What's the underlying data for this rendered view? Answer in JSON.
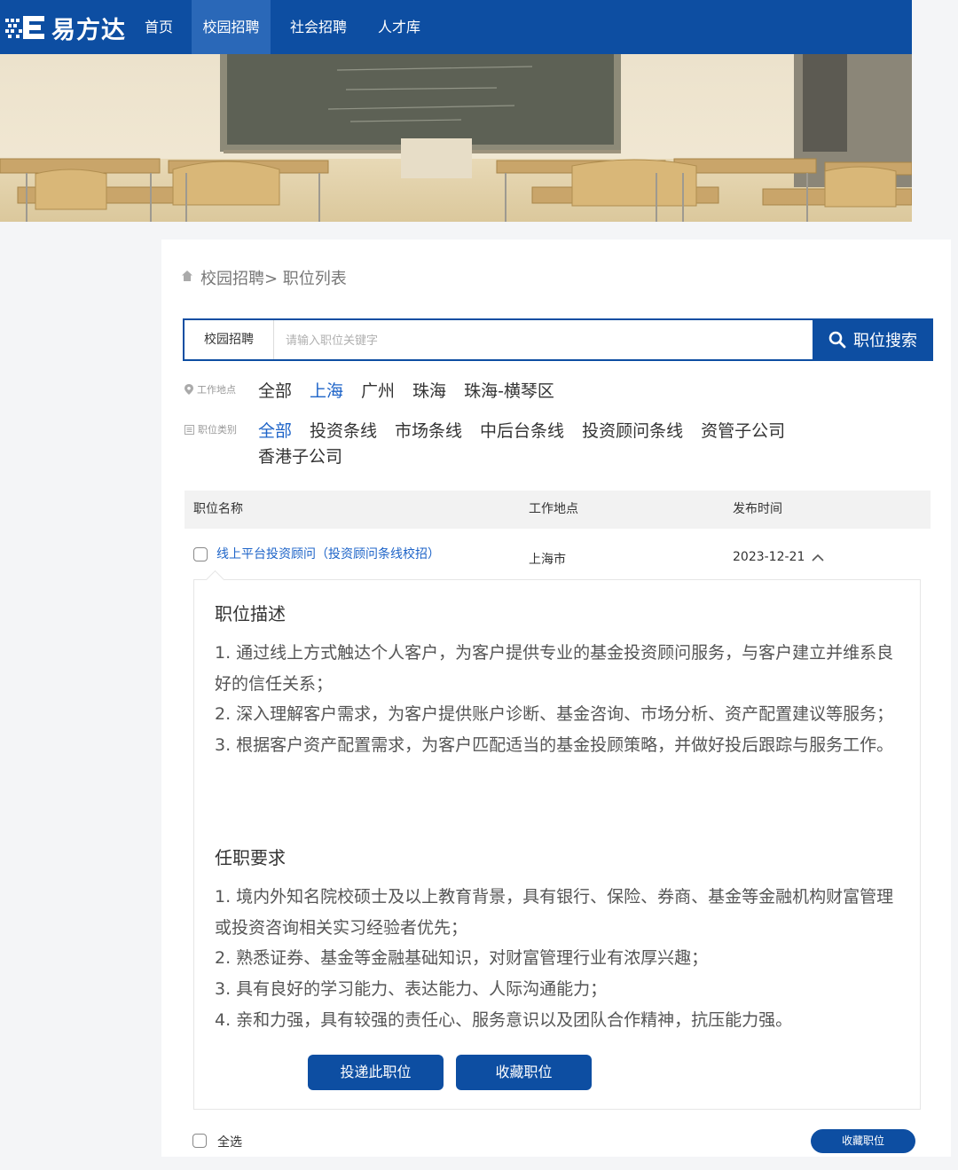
{
  "nav": {
    "brand": "易方达",
    "items": [
      {
        "label": "首页",
        "active": false
      },
      {
        "label": "校园招聘",
        "active": true
      },
      {
        "label": "社会招聘",
        "active": false
      },
      {
        "label": "人才库",
        "active": false
      }
    ]
  },
  "breadcrumb": "校园招聘> 职位列表",
  "search": {
    "scope": "校园招聘",
    "placeholder": "请输入职位关键字",
    "button_label": "职位搜索"
  },
  "filters": {
    "location": {
      "label": "工作地点",
      "options": [
        "全部",
        "上海",
        "广州",
        "珠海",
        "珠海-横琴区"
      ],
      "selected": "上海"
    },
    "category": {
      "label": "职位类别",
      "options": [
        "全部",
        "投资条线",
        "市场条线",
        "中后台条线",
        "投资顾问条线",
        "资管子公司",
        "香港子公司"
      ],
      "selected": "全部"
    }
  },
  "table": {
    "headers": {
      "title": "职位名称",
      "location": "工作地点",
      "date": "发布时间"
    },
    "rows": [
      {
        "title": "线上平台投资顾问（投资顾问条线校招）",
        "location": "上海市",
        "date": "2023-12-21",
        "expanded": true
      }
    ]
  },
  "detail": {
    "desc_title": "职位描述",
    "desc": [
      "1. 通过线上方式触达个人客户，为客户提供专业的基金投资顾问服务，与客户建立并维系良好的信任关系；",
      "2. 深入理解客户需求，为客户提供账户诊断、基金咨询、市场分析、资产配置建议等服务；",
      "3. 根据客户资产配置需求，为客户匹配适当的基金投顾策略，并做好投后跟踪与服务工作。"
    ],
    "req_title": "任职要求",
    "req": [
      "1. 境内外知名院校硕士及以上教育背景，具有银行、保险、券商、基金等金融机构财富管理或投资咨询相关实习经验者优先；",
      "2. 熟悉证券、基金等金融基础知识，对财富管理行业有浓厚兴趣；",
      "3. 具有良好的学习能力、表达能力、人际沟通能力；",
      "4. 亲和力强，具有较强的责任心、服务意识以及团队合作精神，抗压能力强。"
    ],
    "apply_label": "投递此职位",
    "favorite_label": "收藏职位"
  },
  "footer": {
    "select_all_label": "全选",
    "favorite_label": "收藏职位"
  },
  "colors": {
    "brand_blue": "#0d4ea2",
    "link_blue": "#1e64c8",
    "nav_active": "#2a68b8"
  }
}
